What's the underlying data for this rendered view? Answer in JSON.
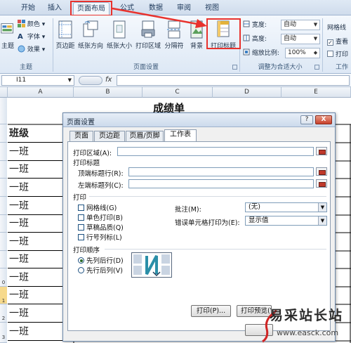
{
  "ribbon_tabs": [
    {
      "label": "开始"
    },
    {
      "label": "插入"
    },
    {
      "label": "页面布局",
      "active": true
    },
    {
      "label": "公式"
    },
    {
      "label": "数据"
    },
    {
      "label": "审阅"
    },
    {
      "label": "视图"
    }
  ],
  "theme_group": {
    "label": "主题",
    "themes_btn": "主题",
    "colors": "颜色",
    "fonts": "字体",
    "effects": "效果"
  },
  "page_setup_group": {
    "label": "页面设置",
    "buttons": [
      "页边距",
      "纸张方向",
      "纸张大小",
      "打印区域",
      "分隔符",
      "背景",
      "打印标题"
    ]
  },
  "scale_group": {
    "label": "调整为合适大小",
    "width_label": "宽度:",
    "width_value": "自动",
    "height_label": "高度:",
    "height_value": "自动",
    "scale_label": "缩放比例:",
    "scale_value": "100%"
  },
  "sheet_options_group": {
    "gridlines_label": "网格线",
    "view": "查看",
    "print": "打印",
    "label_partial": "工作"
  },
  "formula_bar": {
    "name_box": "I11",
    "fx": "fx",
    "content": ""
  },
  "columns": [
    "A",
    "B",
    "C",
    "D",
    "E"
  ],
  "sheet": {
    "title": "成绩单",
    "header": "班级",
    "rows": [
      "一班",
      "一班",
      "一班",
      "一班",
      "一班",
      "一班",
      "一班",
      "一班",
      "一班",
      "一班",
      "一班"
    ],
    "row_numbers_partial": [
      "0",
      "1",
      "2",
      "3"
    ]
  },
  "dialog": {
    "title": "页面设置",
    "help": "?",
    "close": "X",
    "tabs": [
      {
        "label": "页面"
      },
      {
        "label": "页边距"
      },
      {
        "label": "页眉/页脚"
      },
      {
        "label": "工作表",
        "active": true
      }
    ],
    "print_area_label": "打印区域(A):",
    "print_titles_label": "打印标题",
    "top_rows_label": "顶端标题行(R):",
    "left_cols_label": "左端标题列(C):",
    "print_section_label": "打印",
    "checkboxes": [
      {
        "label": "网格线(G)"
      },
      {
        "label": "单色打印(B)"
      },
      {
        "label": "草稿品质(Q)"
      },
      {
        "label": "行号列标(L)"
      }
    ],
    "comments_label": "批注(M):",
    "comments_value": "(无)",
    "errors_label": "错误单元格打印为(E):",
    "errors_value": "显示值",
    "order_label": "打印顺序",
    "order_options": [
      {
        "label": "先列后行(D)",
        "selected": true
      },
      {
        "label": "先行后列(V)",
        "selected": false
      }
    ],
    "buttons": {
      "print": "打印(P)...",
      "preview": "打印预览(W)"
    }
  },
  "watermark": {
    "main": "易采站长站",
    "url": "www.easck.com"
  }
}
